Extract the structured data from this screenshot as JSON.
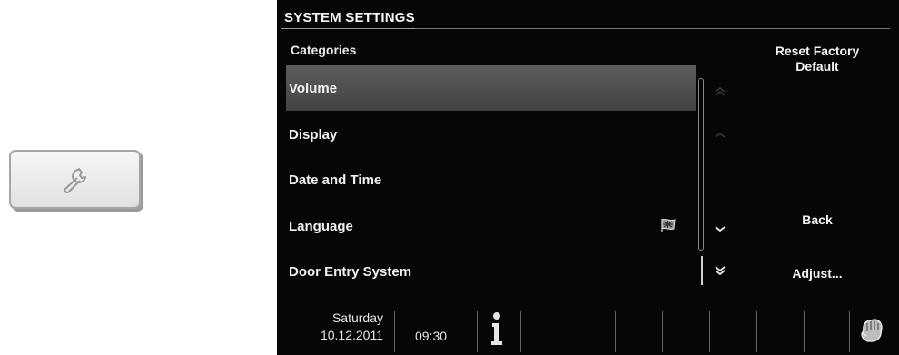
{
  "screen": {
    "title": "SYSTEM SETTINGS",
    "categories_label": "Categories",
    "items": [
      {
        "label": "Volume",
        "selected": true
      },
      {
        "label": "Display",
        "selected": false
      },
      {
        "label": "Date and Time",
        "selected": false
      },
      {
        "label": "Language",
        "selected": false
      },
      {
        "label": "Door Entry System",
        "selected": false
      }
    ],
    "right_buttons": {
      "reset_line1": "Reset Factory",
      "reset_line2": "Default",
      "back": "Back",
      "adjust": "Adjust..."
    },
    "footer": {
      "day": "Saturday",
      "date": "10.12.2011",
      "time": "09:30"
    }
  },
  "icons": {
    "tile": "wrench-icon",
    "language": "flag-icon",
    "info": "info-icon",
    "touch": "hand-touch-icon",
    "scroll": [
      "double-chevron-up-icon",
      "chevron-up-icon",
      "chevron-down-icon",
      "double-chevron-down-icon"
    ]
  },
  "colors": {
    "screen_bg": "#060606",
    "selected_row": "#555555",
    "text": "#f2f2f2"
  }
}
